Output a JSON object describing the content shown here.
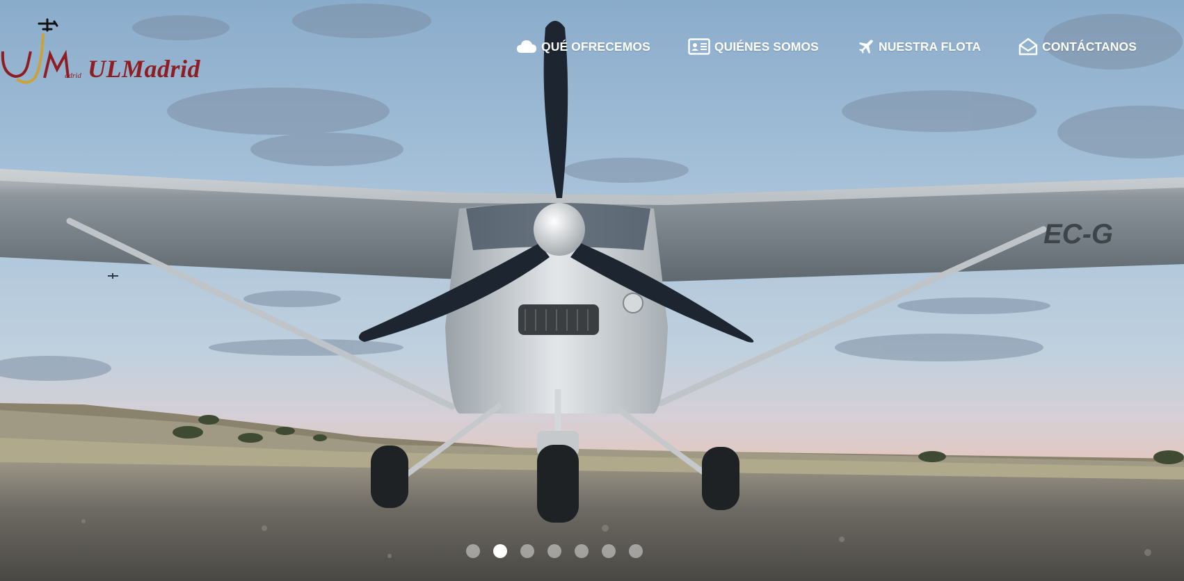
{
  "logo": {
    "brand_text_prefix": "UL",
    "brand_text_suffix": "Madrid",
    "mark_small_text": "adrid"
  },
  "nav": {
    "items": [
      {
        "label": "QUÉ OFRECEMOS",
        "icon": "cloud-icon"
      },
      {
        "label": "QUIÉNES SOMOS",
        "icon": "id-card-icon"
      },
      {
        "label": "NUESTRA FLOTA",
        "icon": "plane-icon"
      },
      {
        "label": "CONTÁCTANOS",
        "icon": "envelope-icon"
      }
    ]
  },
  "hero": {
    "aircraft_registration": "EC-G",
    "slider": {
      "total": 7,
      "active_index": 1
    }
  },
  "colors": {
    "brand_red": "#8e1e22",
    "brand_gold": "#c9a23a",
    "nav_text": "#ffffff"
  }
}
